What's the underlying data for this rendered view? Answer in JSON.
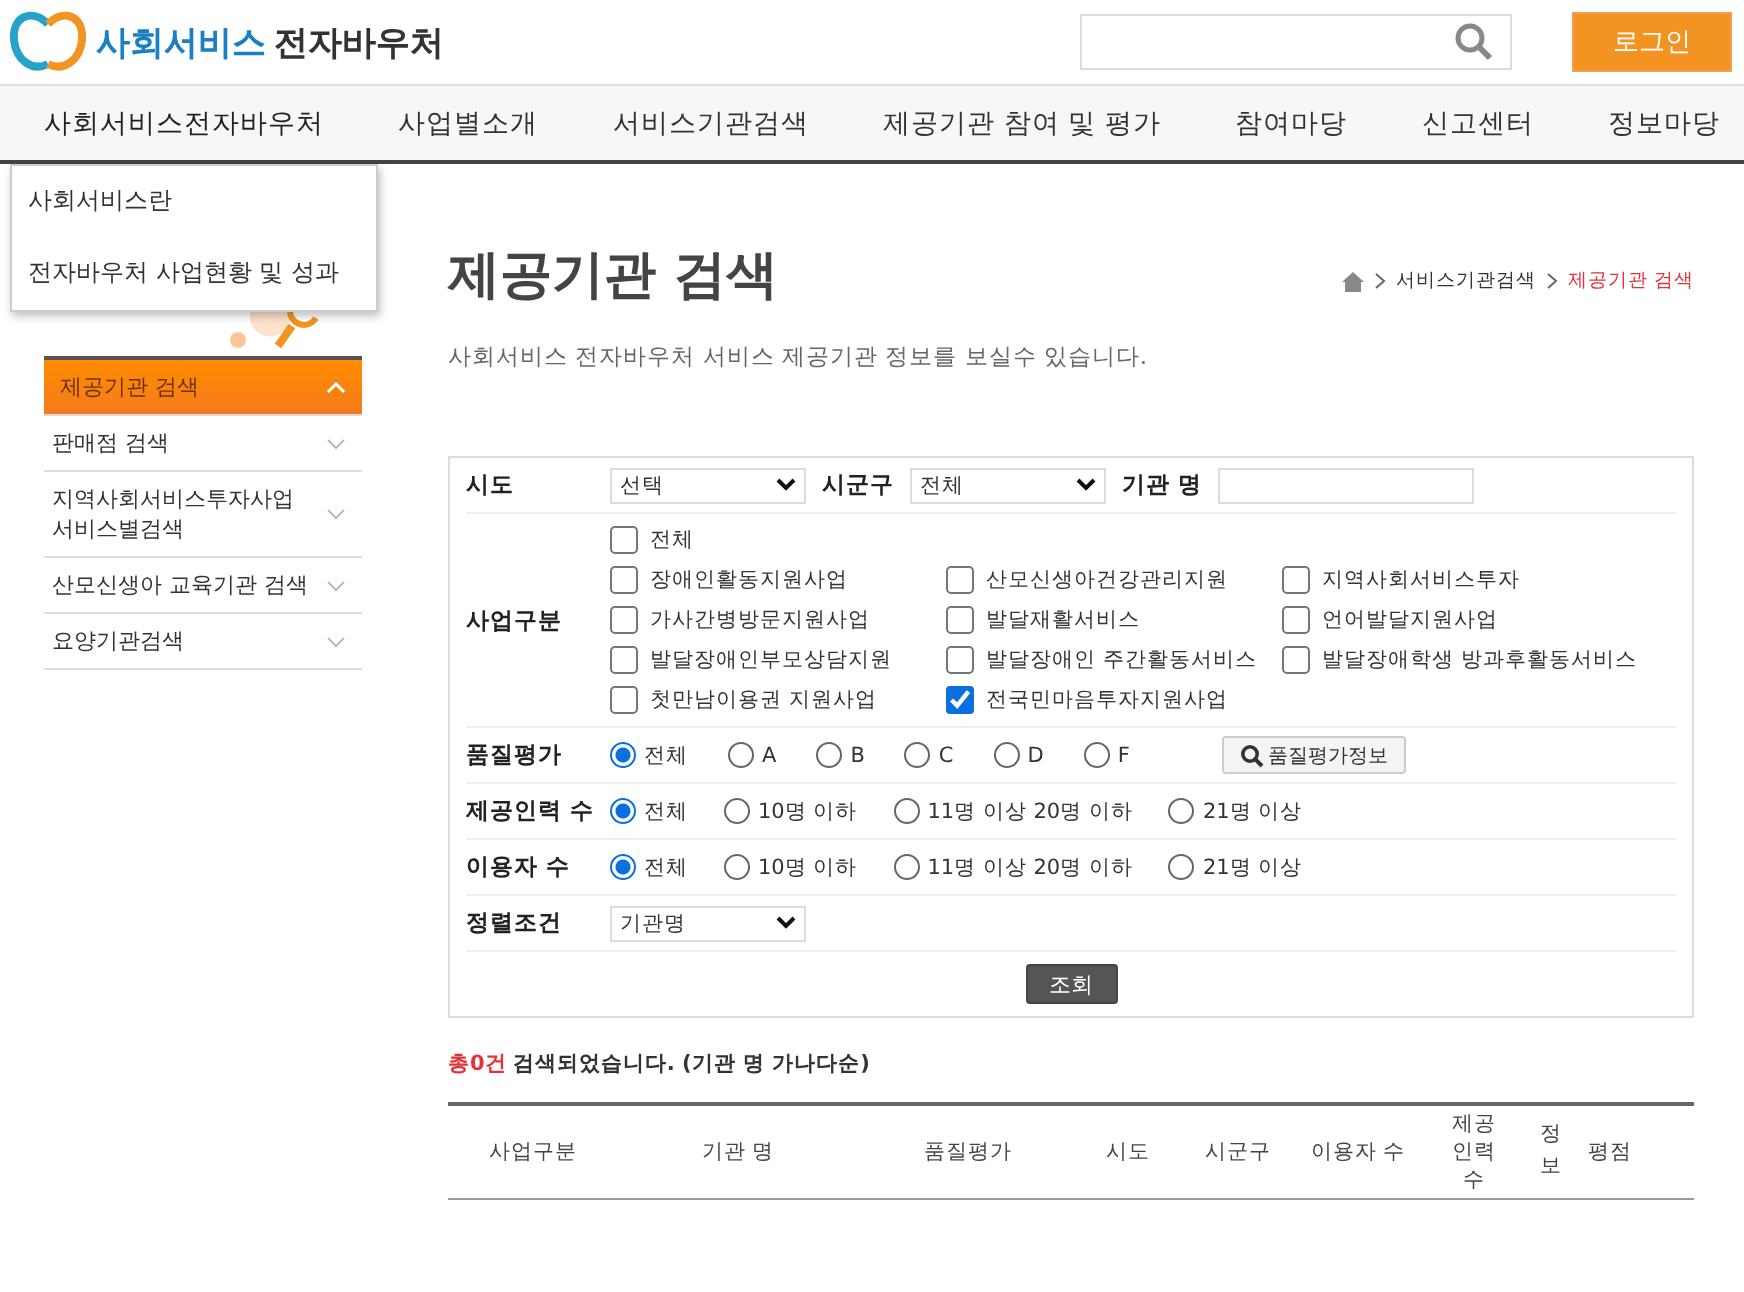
{
  "header": {
    "logo_primary": "사회서비스",
    "logo_secondary": "전자바우처",
    "login": "로그인"
  },
  "nav": {
    "items": [
      {
        "label": "사회서비스전자바우처",
        "expanded": true
      },
      {
        "label": "사업별소개",
        "expanded": false
      },
      {
        "label": "서비스기관검색",
        "expanded": false
      },
      {
        "label": "제공기관 참여 및 평가",
        "expanded": false
      },
      {
        "label": "참여마당",
        "expanded": false
      },
      {
        "label": "신고센터",
        "expanded": false
      },
      {
        "label": "정보마당",
        "expanded": false
      }
    ],
    "dropdown": [
      "사회서비스란",
      "전자바우처 사업현황 및 성과"
    ]
  },
  "sidebar": {
    "items": [
      {
        "label": "제공기관 검색",
        "selected": true
      },
      {
        "label": "판매점 검색",
        "selected": false
      },
      {
        "label": "지역사회서비스투자사업 서비스별검색",
        "selected": false
      },
      {
        "label": "산모신생아 교육기관 검색",
        "selected": false
      },
      {
        "label": "요양기관검색",
        "selected": false
      }
    ]
  },
  "breadcrumb": [
    "서비스기관검색",
    "제공기관 검색"
  ],
  "title": "제공기관 검색",
  "subtitle": "사회서비스 전자바우처 서비스 제공기관 정보를 보실수 있습니다.",
  "form": {
    "location": [
      {
        "label": "시도",
        "kind": "select",
        "value": "선택"
      },
      {
        "label": "시군구",
        "kind": "select",
        "value": "전체"
      },
      {
        "label": "기관 명",
        "kind": "input"
      }
    ],
    "category": {
      "label": "사업구분",
      "all": {
        "label": "전체",
        "checked": false
      },
      "options": [
        {
          "label": "장애인활동지원사업",
          "checked": false
        },
        {
          "label": "산모신생아건강관리지원",
          "checked": false
        },
        {
          "label": "지역사회서비스투자",
          "checked": false
        },
        {
          "label": "가사간병방문지원사업",
          "checked": false
        },
        {
          "label": "발달재활서비스",
          "checked": false
        },
        {
          "label": "언어발달지원사업",
          "checked": false
        },
        {
          "label": "발달장애인부모상담지원",
          "checked": false
        },
        {
          "label": "발달장애인 주간활동서비스",
          "checked": false
        },
        {
          "label": "발달장애학생 방과후활동서비스",
          "checked": false
        },
        {
          "label": "첫만남이용권 지원사업",
          "checked": false
        },
        {
          "label": "전국민마음투자지원사업",
          "checked": true
        }
      ]
    },
    "radio_groups": [
      {
        "label": "품질평가",
        "kind": "grade",
        "options": [
          {
            "label": "전체",
            "selected": true
          },
          {
            "label": "A",
            "selected": false
          },
          {
            "label": "B",
            "selected": false
          },
          {
            "label": "C",
            "selected": false
          },
          {
            "label": "D",
            "selected": false
          },
          {
            "label": "F",
            "selected": false
          }
        ],
        "button": "품질평가정보"
      },
      {
        "label": "제공인력 수",
        "kind": "range",
        "options": [
          {
            "label": "전체",
            "selected": true
          },
          {
            "label": "10명 이하",
            "selected": false
          },
          {
            "label": "11명 이상 20명 이하",
            "selected": false
          },
          {
            "label": "21명 이상",
            "selected": false
          }
        ]
      },
      {
        "label": "이용자 수",
        "kind": "range",
        "options": [
          {
            "label": "전체",
            "selected": true
          },
          {
            "label": "10명 이하",
            "selected": false
          },
          {
            "label": "11명 이상 20명 이하",
            "selected": false
          },
          {
            "label": "21명 이상",
            "selected": false
          }
        ]
      }
    ],
    "sort": {
      "label": "정렬조건",
      "value": "기관명"
    },
    "submit": "조회"
  },
  "result": {
    "count": "총0건",
    "message": "검색되었습니다. (기관 명 가나다순)"
  },
  "table": {
    "columns": [
      "사업구분",
      "기관 명",
      "품질평가",
      "시도",
      "시군구",
      "이용자 수",
      "제공 인력 수",
      "정보",
      "평점"
    ]
  }
}
